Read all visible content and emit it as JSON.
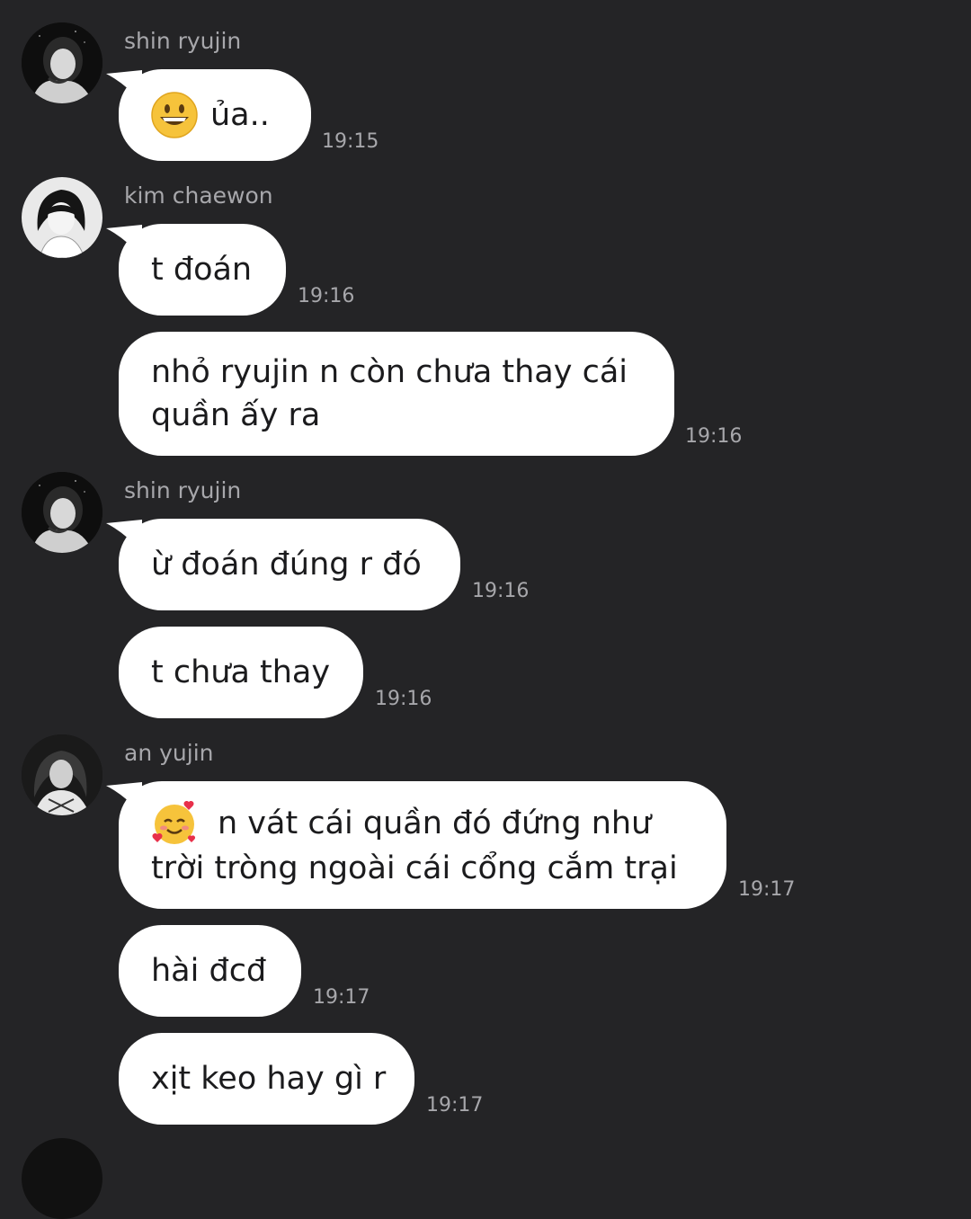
{
  "messages": [
    {
      "sender": "shin ryujin",
      "text": "ủa..",
      "time": "19:15",
      "emoji": "grinning-face"
    },
    {
      "sender": "kim chaewon",
      "text": "t đoán",
      "time": "19:16"
    },
    {
      "lines": [
        "nhỏ ryujin n còn chưa thay cái",
        "quần ấy ra"
      ],
      "time": "19:16"
    },
    {
      "sender": "shin ryujin",
      "text": "ừ đoán đúng r đó",
      "time": "19:16"
    },
    {
      "text": "t chưa thay",
      "time": "19:16"
    },
    {
      "sender": "an yujin",
      "lines": [
        "n vát cái quần đó đứng như",
        "trời tròng ngoài cái cổng cắm trại"
      ],
      "time": "19:17",
      "emoji": "smiling-face-with-hearts"
    },
    {
      "text": "hài đcđ",
      "time": "19:17"
    },
    {
      "text": "xịt keo hay gì r",
      "time": "19:17"
    }
  ]
}
